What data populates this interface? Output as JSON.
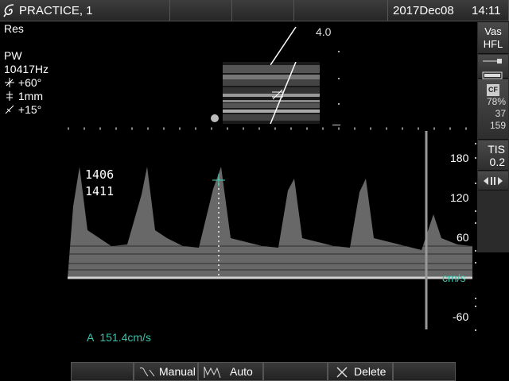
{
  "header": {
    "exam_label": "PRACTICE, 1",
    "date": "2017Dec08",
    "time": "14:11"
  },
  "info": {
    "mode_res": "Res",
    "mode_pw": "PW",
    "prf": "10417Hz",
    "angle": "+60°",
    "gate": "1mm",
    "steer": "+15°"
  },
  "image": {
    "depth": "4.0",
    "heart_rates": [
      "1406",
      "1411"
    ],
    "measurement": "A  151.4cm/s"
  },
  "scale": {
    "unit": "cm/s",
    "ticks": [
      "180",
      "120",
      "60",
      "-60"
    ]
  },
  "right_panel": {
    "preset_line1": "Vas",
    "preset_line2": "HFL",
    "cf_badge": "CF",
    "gain": "78%",
    "cf_val1": "37",
    "cf_val2": "159",
    "tis_label": "TIS",
    "tis_value": "0.2"
  },
  "softkeys": {
    "manual": "Manual",
    "auto": "Auto",
    "delete": "Delete"
  },
  "colors": {
    "accent_teal": "#3cc1a8",
    "panel_gray": "#2b2b2b"
  }
}
